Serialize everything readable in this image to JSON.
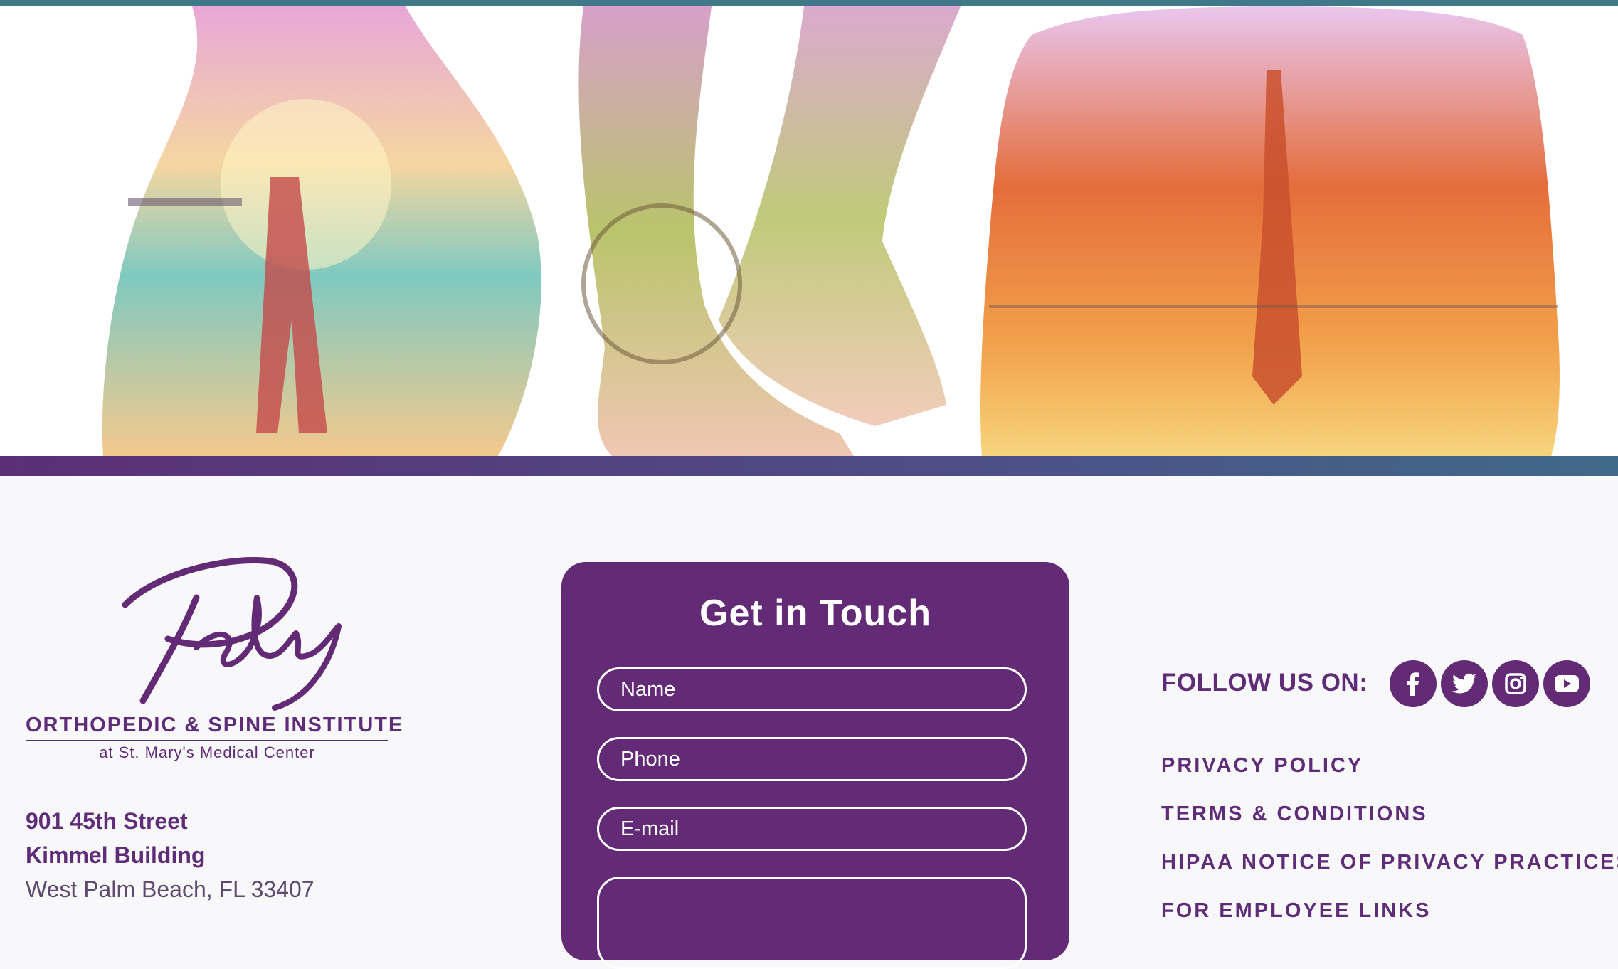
{
  "hero": {
    "image": "body silhouettes with lifestyle scenes (family on beach, cyclist legs, yoga pose on back)"
  },
  "logo": {
    "signature": "Paley",
    "name": "ORTHOPEDIC & SPINE INSTITUTE",
    "subtitle": "at St. Mary's Medical Center"
  },
  "address": {
    "line1": "901 45th Street",
    "line2": "Kimmel Building",
    "line3": "West Palm Beach, FL  33407"
  },
  "contact_form": {
    "title": "Get in Touch",
    "name_placeholder": "Name",
    "phone_placeholder": "Phone",
    "email_placeholder": "E-mail",
    "message_placeholder": ""
  },
  "follow": {
    "label": "FOLLOW US ON:",
    "icons": [
      "facebook-icon",
      "twitter-icon",
      "instagram-icon",
      "youtube-icon"
    ]
  },
  "footer_links": [
    {
      "label": "PRIVACY POLICY"
    },
    {
      "label": "TERMS & CONDITIONS"
    },
    {
      "label": "HIPAA NOTICE OF PRIVACY PRACTICES"
    },
    {
      "label": "FOR EMPLOYEE LINKS"
    }
  ],
  "colors": {
    "brand_purple": "#632b75",
    "text_purple": "#5f2c78",
    "top_strip": "#3f7888",
    "background": "#f8f8fa"
  }
}
